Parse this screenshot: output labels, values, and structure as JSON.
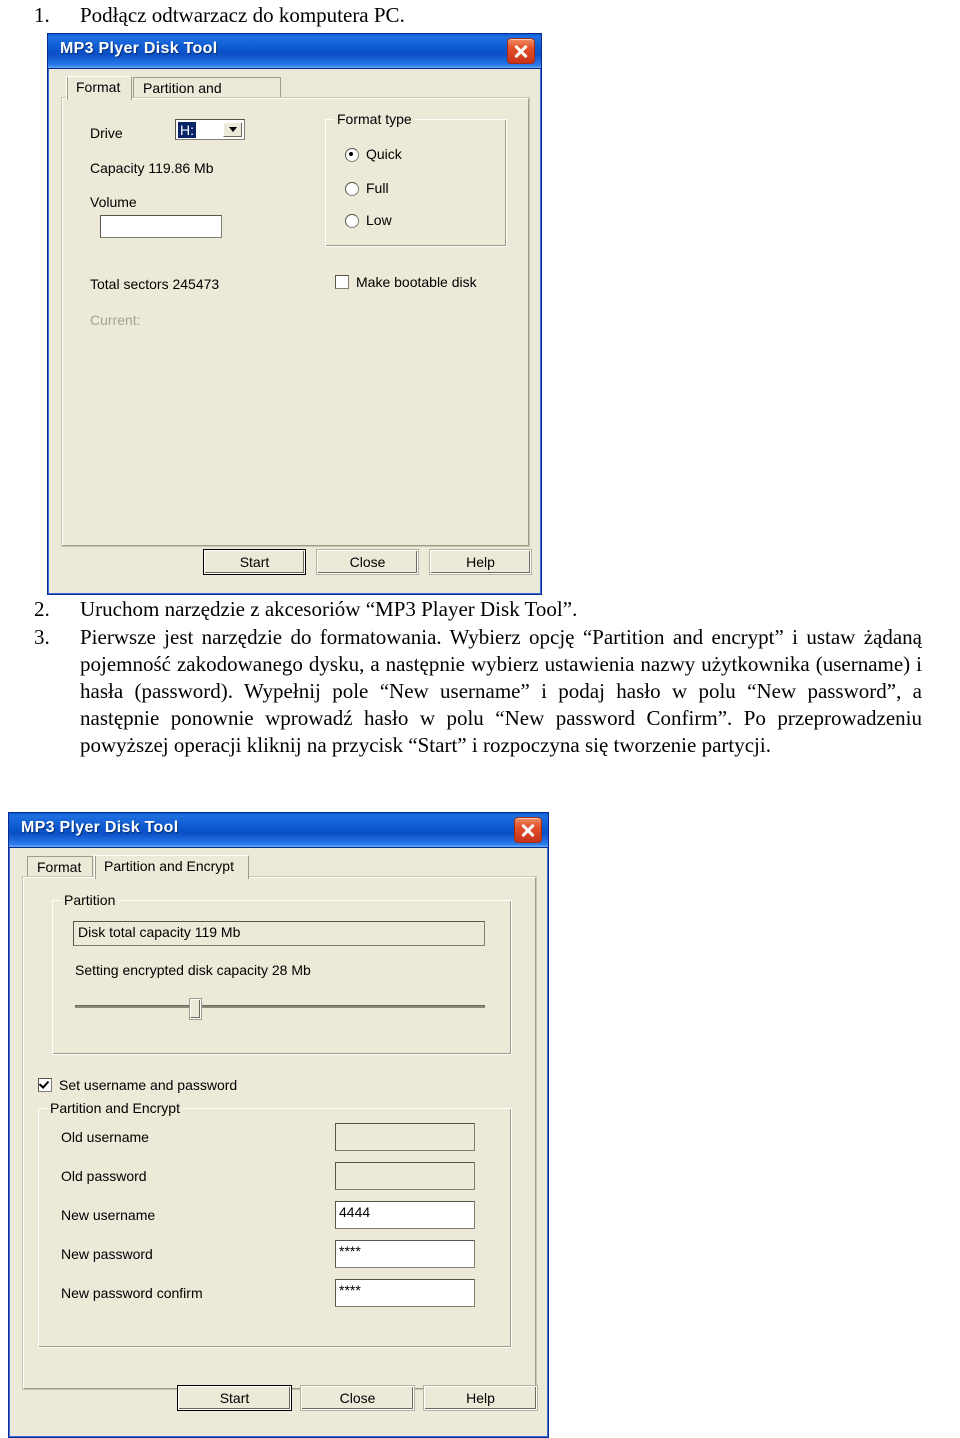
{
  "document": {
    "steps": [
      {
        "num": "1.",
        "text": "Podłącz odtwarzacz do komputera PC."
      },
      {
        "num": "2.",
        "text": "Uruchom narzędzie z akcesoriów “MP3 Player Disk Tool”."
      },
      {
        "num": "3.",
        "text": "Pierwsze jest narzędzie do formatowania. Wybierz opcję “Partition and encrypt” i ustaw żądaną pojemność zakodowanego dysku, a następnie wybierz ustawienia nazwy użytkownika (username) i hasła (password). Wypełnij pole “New username” i podaj hasło w polu “New password”, a następnie ponownie wprowadź hasło w polu “New password Confirm”. Po przeprowadzeniu powyższej operacji kliknij na przycisk “Start” i rozpoczyna się tworzenie partycji."
      }
    ]
  },
  "colors": {
    "title_blue": "#0b56cf",
    "face": "#ece9d8",
    "close_red": "#c8331a",
    "selection_blue": "#0a246a"
  },
  "dialog_format": {
    "title": "MP3 Plyer Disk Tool",
    "close_icon": "close-icon",
    "tabs": [
      {
        "label": "Format",
        "active": true
      },
      {
        "label": "Partition and Encrypt",
        "active": false
      }
    ],
    "drive_label": "Drive",
    "drive_value": "H:",
    "capacity_label": "Capacity 119.86 Mb",
    "volume_label": "Volume",
    "volume_value": "",
    "total_sectors_label": "Total sectors 245473",
    "current_label": "Current:",
    "format_type": {
      "caption": "Format type",
      "options": [
        {
          "label": "Quick",
          "selected": true
        },
        {
          "label": "Full",
          "selected": false
        },
        {
          "label": "Low",
          "selected": false
        }
      ]
    },
    "bootable": {
      "label": "Make bootable disk",
      "checked": false
    },
    "buttons": [
      {
        "label": "Start",
        "default": true
      },
      {
        "label": "Close",
        "default": false
      },
      {
        "label": "Help",
        "default": false
      }
    ]
  },
  "dialog_partition": {
    "title": "MP3 Plyer Disk Tool",
    "close_icon": "close-icon",
    "tabs": [
      {
        "label": "Format",
        "active": false
      },
      {
        "label": "Partition and Encrypt",
        "active": true
      }
    ],
    "partition_group": {
      "caption": "Partition",
      "total_capacity": "Disk total capacity 119 Mb",
      "encrypted_capacity": "Setting encrypted disk capacity 28 Mb",
      "slider_percent": 28
    },
    "set_credentials": {
      "label": "Set username and password",
      "checked": true
    },
    "credentials_group": {
      "caption": "Partition and Encrypt",
      "fields": [
        {
          "label": "Old username",
          "value": "",
          "disabled": true
        },
        {
          "label": "Old password",
          "value": "",
          "disabled": true
        },
        {
          "label": "New username",
          "value": "4444",
          "disabled": false
        },
        {
          "label": "New password",
          "value": "****",
          "disabled": false
        },
        {
          "label": "New password confirm",
          "value": "****",
          "disabled": false
        }
      ]
    },
    "buttons": [
      {
        "label": "Start",
        "default": true
      },
      {
        "label": "Close",
        "default": false
      },
      {
        "label": "Help",
        "default": false
      }
    ]
  }
}
